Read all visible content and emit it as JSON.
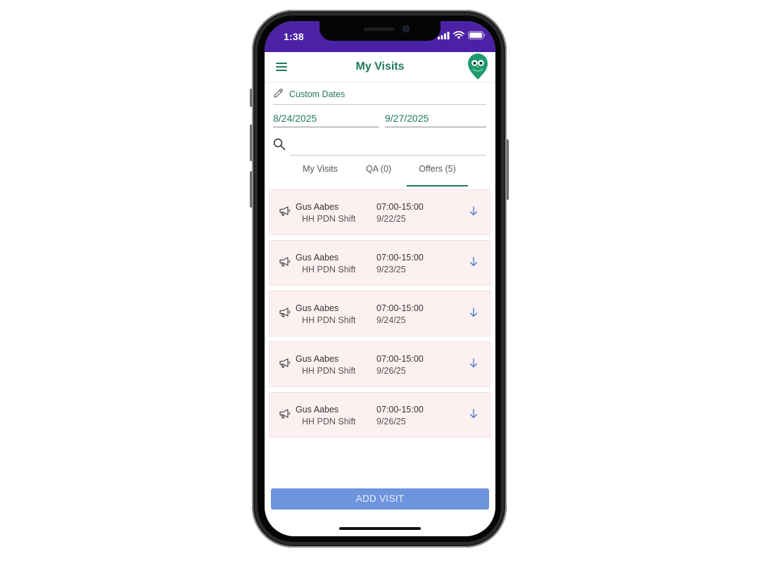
{
  "status_bar": {
    "time": "1:38"
  },
  "header": {
    "title": "My Visits",
    "menu_icon": "hamburger-menu-icon",
    "logo_icon": "owl-logo-icon"
  },
  "filters": {
    "custom_dates_label": "Custom Dates",
    "start_date": "8/24/2025",
    "end_date": "9/27/2025",
    "search_value": ""
  },
  "tabs": [
    {
      "label": "My Visits",
      "active": false
    },
    {
      "label": "QA (0)",
      "active": false
    },
    {
      "label": "Offers (5)",
      "active": true
    }
  ],
  "offers": [
    {
      "client": "Gus Aabes",
      "service": "HH PDN Shift",
      "time": "07:00-15:00",
      "date": "9/22/25"
    },
    {
      "client": "Gus Aabes",
      "service": "HH PDN Shift",
      "time": "07:00-15:00",
      "date": "9/23/25"
    },
    {
      "client": "Gus Aabes",
      "service": "HH PDN Shift",
      "time": "07:00-15:00",
      "date": "9/24/25"
    },
    {
      "client": "Gus Aabes",
      "service": "HH PDN Shift",
      "time": "07:00-15:00",
      "date": "9/26/25"
    },
    {
      "client": "Gus Aabes",
      "service": "HH PDN Shift",
      "time": "07:00-15:00",
      "date": "9/26/25"
    }
  ],
  "actions": {
    "add_visit_label": "ADD VISIT"
  },
  "colors": {
    "status_bar": "#4b22a6",
    "accent_green": "#1e7a5c",
    "card_background": "#fdf0f1",
    "add_button": "#6e94de",
    "arrow_blue": "#4a78c8"
  }
}
